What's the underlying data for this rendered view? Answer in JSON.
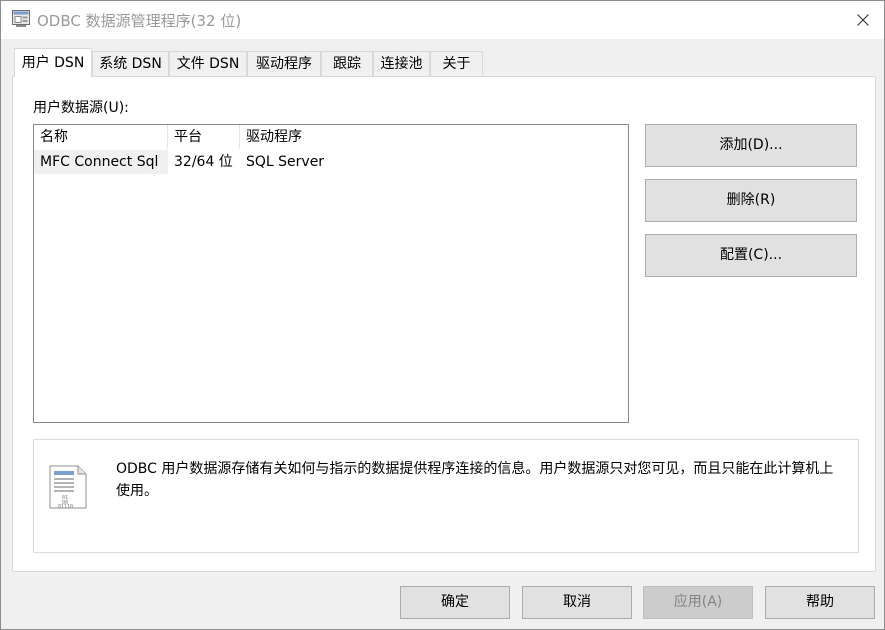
{
  "window": {
    "title": "ODBC 数据源管理程序(32 位)",
    "close_icon": "close-icon",
    "app_icon": "odbc-app-icon"
  },
  "tabs": [
    {
      "label": "用户 DSN",
      "active": true
    },
    {
      "label": "系统 DSN",
      "active": false
    },
    {
      "label": "文件 DSN",
      "active": false
    },
    {
      "label": "驱动程序",
      "active": false
    },
    {
      "label": "跟踪",
      "active": false
    },
    {
      "label": "连接池",
      "active": false
    },
    {
      "label": "关于",
      "active": false
    }
  ],
  "panel": {
    "section_label": "用户数据源(U):",
    "columns": [
      "名称",
      "平台",
      "驱动程序"
    ],
    "rows": [
      {
        "name": "MFC Connect Sql",
        "platform": "32/64 位",
        "driver": "SQL Server"
      }
    ],
    "buttons": {
      "add": "添加(D)...",
      "remove": "删除(R)",
      "configure": "配置(C)..."
    },
    "info": {
      "icon": "data-document-icon",
      "text": "ODBC 用户数据源存储有关如何与指示的数据提供程序连接的信息。用户数据源只对您可见，而且只能在此计算机上使用。"
    }
  },
  "footer": {
    "ok": "确定",
    "cancel": "取消",
    "apply": "应用(A)",
    "help": "帮助"
  },
  "colors": {
    "window_bg": "#f0f0f0",
    "button_bg": "#e1e1e1",
    "button_border": "#adadad",
    "disabled_text": "#838383"
  }
}
